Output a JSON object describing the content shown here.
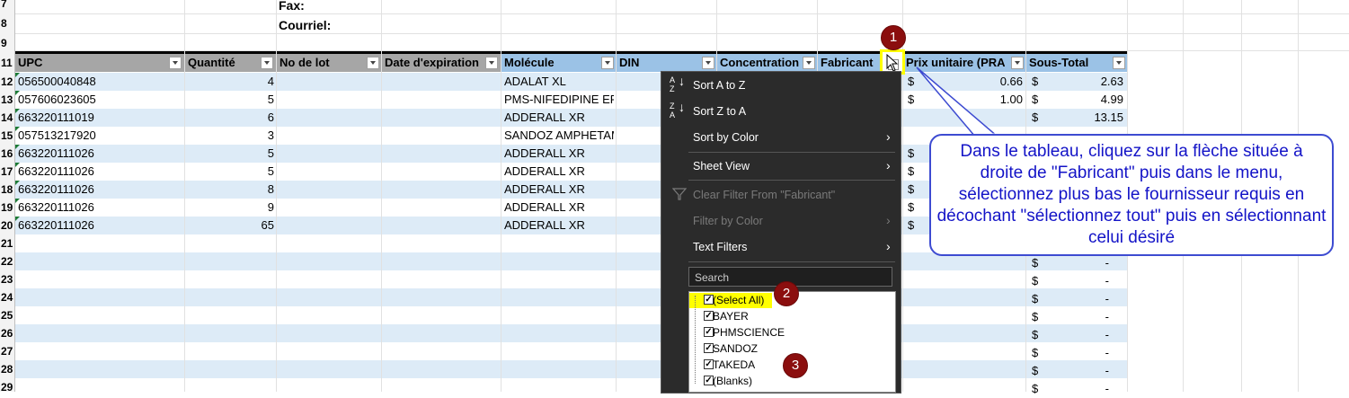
{
  "top": {
    "fax_label": "Fax:",
    "courriel_label": "Courriel:"
  },
  "row_numbers": [
    "7",
    "8",
    "9",
    "11",
    "12",
    "13",
    "14",
    "15",
    "16",
    "17",
    "18",
    "19",
    "20",
    "21",
    "22",
    "23",
    "24",
    "25",
    "26",
    "27",
    "28",
    "29"
  ],
  "headers": {
    "upc": "UPC",
    "quantite": "Quantité",
    "lot": "No de lot",
    "expiration": "Date d'expiration",
    "molecule": "Molécule",
    "din": "DIN",
    "concentration": "Concentration",
    "fabricant": "Fabricant",
    "prix": "Prix unitaire (PRA)",
    "soustotal": "Sous-Total"
  },
  "rows": [
    {
      "upc": "056500040848",
      "qty": "4",
      "molecule": "ADALAT XL",
      "cur": "$",
      "price": "0.66",
      "cur2": "$",
      "subtotal": "2.63"
    },
    {
      "upc": "057606023605",
      "qty": "5",
      "molecule": "PMS-NIFEDIPINE ER",
      "cur": "$",
      "price": "1.00",
      "cur2": "$",
      "subtotal": "4.99"
    },
    {
      "upc": "663220111019",
      "qty": "6",
      "molecule": "ADDERALL XR",
      "cur": "$",
      "price": "",
      "cur2": "$",
      "subtotal": "13.15"
    },
    {
      "upc": "057513217920",
      "qty": "3",
      "molecule": "SANDOZ AMPHETAM",
      "cur": "",
      "price": "",
      "cur2": "",
      "subtotal": ""
    },
    {
      "upc": "663220111026",
      "qty": "5",
      "molecule": "ADDERALL XR",
      "cur": "$",
      "price": "",
      "cur2": "",
      "subtotal": ""
    },
    {
      "upc": "663220111026",
      "qty": "5",
      "molecule": "ADDERALL XR",
      "cur": "$",
      "price": "",
      "cur2": "",
      "subtotal": ""
    },
    {
      "upc": "663220111026",
      "qty": "8",
      "molecule": "ADDERALL XR",
      "cur": "$",
      "price": "",
      "cur2": "",
      "subtotal": ""
    },
    {
      "upc": "663220111026",
      "qty": "9",
      "molecule": "ADDERALL XR",
      "cur": "$",
      "price": "",
      "cur2": "",
      "subtotal": ""
    },
    {
      "upc": "663220111026",
      "qty": "65",
      "molecule": "ADDERALL XR",
      "cur": "$",
      "price": "",
      "cur2": "",
      "subtotal": ""
    }
  ],
  "empty_rows": [
    {
      "cur": "$",
      "subtotal": "-"
    },
    {
      "cur": "$",
      "subtotal": "-"
    },
    {
      "cur": "$",
      "subtotal": "-"
    },
    {
      "cur": "$",
      "subtotal": "-"
    },
    {
      "cur": "$",
      "subtotal": "-"
    },
    {
      "cur": "$",
      "subtotal": "-"
    },
    {
      "cur": "$",
      "subtotal": "-"
    },
    {
      "cur": "$",
      "subtotal": "-"
    }
  ],
  "menu": {
    "sort_az": "Sort A to Z",
    "sort_za": "Sort Z to A",
    "sort_color": "Sort by Color",
    "sheet_view": "Sheet View",
    "clear_filter": "Clear Filter From \"Fabricant\"",
    "filter_color": "Filter by Color",
    "text_filters": "Text Filters",
    "search_placeholder": "Search",
    "az_icon_top": "A",
    "az_icon_bottom": "Z",
    "za_icon_top": "Z",
    "za_icon_bottom": "A",
    "items": [
      "(Select All)",
      "BAYER",
      "PHMSCIENCE",
      "SANDOZ",
      "TAKEDA",
      "(Blanks)"
    ]
  },
  "badges": [
    "1",
    "2",
    "3"
  ],
  "callout_text": "Dans le tableau, cliquez sur la flèche située à droite de \"Fabricant\" puis dans le menu, sélectionnez plus bas le fournisseur requis en décochant \"sélectionnez tout\" puis en sélectionnant celui désiré",
  "colors": {
    "header_gray": "#a6a6a6",
    "header_blue": "#9bc2e6",
    "band_blue": "#ddebf7",
    "menu_bg": "#2b2b2b",
    "highlight_yellow": "#ffff00",
    "callout_blue": "#1313c7",
    "badge_red": "#8b0e0e"
  }
}
